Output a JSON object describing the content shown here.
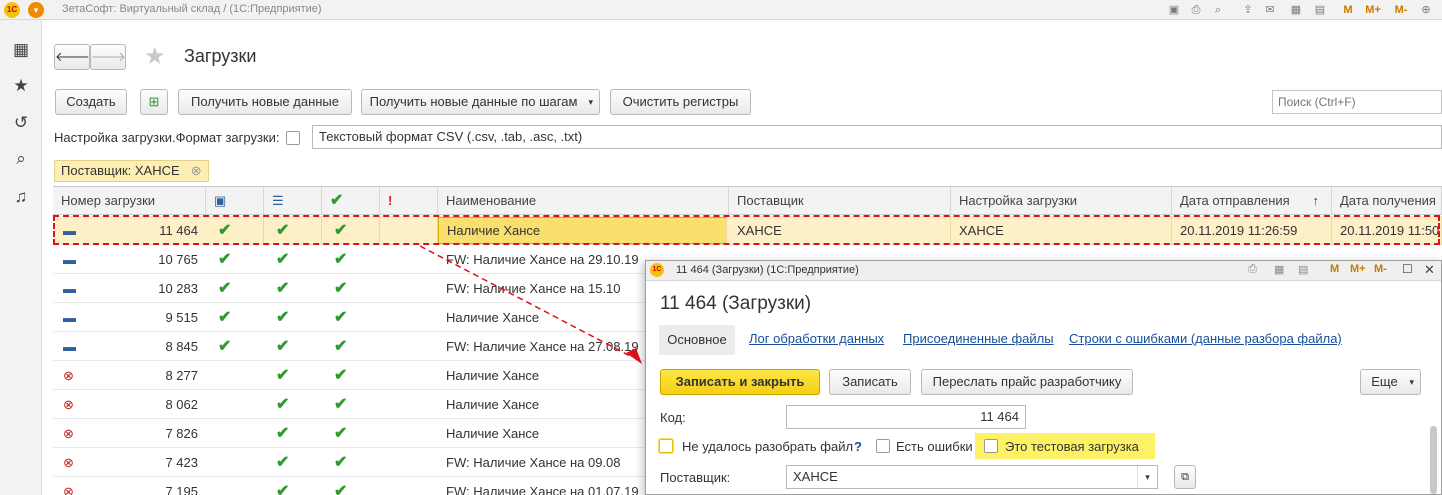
{
  "window": {
    "title": "ЗетаСофт: Виртуальный склад /  (1С:Предприятие)"
  },
  "header": {
    "title": "Загрузки"
  },
  "toolbar": {
    "create": "Создать",
    "get_new": "Получить новые данные",
    "get_by_steps": "Получить новые данные по шагам",
    "clear_registers": "Очистить регистры",
    "search_placeholder": "Поиск (Ctrl+F)"
  },
  "settings": {
    "label": "Настройка загрузки.Формат загрузки:",
    "value": "Текстовый формат CSV (.csv, .tab, .asc, .txt)"
  },
  "filter": {
    "label": "Поставщик: ХАНСЕ"
  },
  "grid": {
    "headers": {
      "number": "Номер загрузки",
      "name": "Наименование",
      "supplier": "Поставщик",
      "setting": "Настройка загрузки",
      "sent": "Дата отправления",
      "received": "Дата получения"
    },
    "rows": [
      {
        "num": "11 464",
        "status": "minus",
        "c1": "✔",
        "c2": "✔",
        "c3": "✔",
        "name": "Наличие Хансе",
        "supplier": "ХАНСЕ",
        "setting": "ХАНСЕ",
        "sent": "20.11.2019 11:26:59",
        "received": "20.11.2019 11:50"
      },
      {
        "num": "10 765",
        "status": "minus",
        "c1": "✔",
        "c2": "✔",
        "c3": "✔",
        "name": "FW: Наличие Хансе на 29.10.19",
        "supplier": "",
        "setting": "",
        "sent": "",
        "received": ""
      },
      {
        "num": "10 283",
        "status": "minus",
        "c1": "✔",
        "c2": "✔",
        "c3": "✔",
        "name": "FW: Наличие Хансе на 15.10",
        "supplier": "",
        "setting": "",
        "sent": "",
        "received": ""
      },
      {
        "num": "9 515",
        "status": "minus",
        "c1": "✔",
        "c2": "✔",
        "c3": "✔",
        "name": "Наличие Хансе",
        "supplier": "",
        "setting": "",
        "sent": "",
        "received": ""
      },
      {
        "num": "8 845",
        "status": "minus",
        "c1": "✔",
        "c2": "✔",
        "c3": "✔",
        "name": "FW: Наличие Хансе на 27.08.19",
        "supplier": "",
        "setting": "",
        "sent": "",
        "received": ""
      },
      {
        "num": "8 277",
        "status": "error",
        "c1": "",
        "c2": "✔",
        "c3": "✔",
        "name": "Наличие Хансе",
        "supplier": "",
        "setting": "",
        "sent": "",
        "received": ""
      },
      {
        "num": "8 062",
        "status": "error",
        "c1": "",
        "c2": "✔",
        "c3": "✔",
        "name": "Наличие Хансе",
        "supplier": "",
        "setting": "",
        "sent": "",
        "received": ""
      },
      {
        "num": "7 826",
        "status": "error",
        "c1": "",
        "c2": "✔",
        "c3": "✔",
        "name": "Наличие Хансе",
        "supplier": "",
        "setting": "",
        "sent": "",
        "received": ""
      },
      {
        "num": "7 423",
        "status": "error",
        "c1": "",
        "c2": "✔",
        "c3": "✔",
        "name": "FW: Наличие Хансе на 09.08",
        "supplier": "",
        "setting": "",
        "sent": "",
        "received": ""
      },
      {
        "num": "7 195",
        "status": "error",
        "c1": "",
        "c2": "✔",
        "c3": "✔",
        "name": "FW: Наличие Хансе на 01.07.19",
        "supplier": "",
        "setting": "",
        "sent": "",
        "received": ""
      }
    ]
  },
  "popup": {
    "titlebar": "11 464 (Загрузки)  (1С:Предприятие)",
    "title": "11 464 (Загрузки)",
    "tabs": {
      "main": "Основное",
      "log": "Лог обработки данных",
      "files": "Присоединенные файлы",
      "errors": "Строки с ошибками (данные разбора файла)"
    },
    "buttons": {
      "save_close": "Записать и закрыть",
      "save": "Записать",
      "forward": "Переслать прайс разработчику",
      "more": "Еще"
    },
    "code_label": "Код:",
    "code_value": "11 464",
    "parse_fail": "Не удалось разобрать файл",
    "help": "?",
    "has_errors": "Есть ошибки",
    "test_load": "Это тестовая загрузка",
    "supplier_label": "Поставщик:",
    "supplier_value": "ХАНСЕ"
  },
  "colors": {
    "accent": "#f4cf16",
    "selected_row": "#fdf0c6",
    "annotation": "#e0101a"
  }
}
